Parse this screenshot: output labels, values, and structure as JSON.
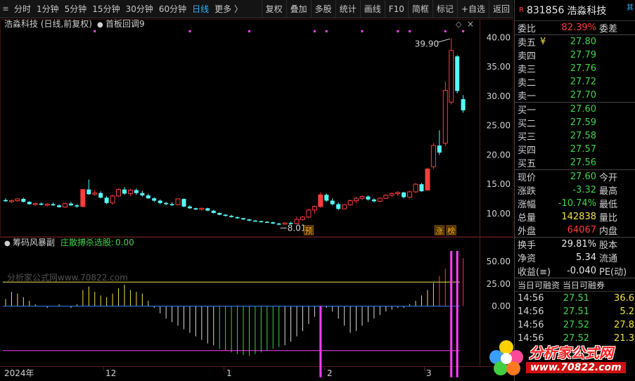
{
  "toolbar": {
    "periods": [
      "分时",
      "1分钟",
      "5分钟",
      "15分钟",
      "30分钟",
      "60分钟",
      "日线",
      "更多 〉"
    ],
    "active_period": "日线",
    "buttons": [
      "复权",
      "叠加",
      "多股",
      "统计",
      "画线",
      "F10",
      "简框",
      "标记",
      "+自选",
      "返回"
    ]
  },
  "main_chart": {
    "title": "浩淼科技 (日线,前复权)",
    "indicator": "首板回调9",
    "price_ticks": [
      "40.00",
      "35.00",
      "30.00",
      "25.00",
      "20.00",
      "15.00",
      "10.00"
    ],
    "high_label": "39.90",
    "low_label": "8.01",
    "badge_yu": "预",
    "badge_zhang": "涨",
    "badge_bang": "榜"
  },
  "sub_chart": {
    "name": "筹码风暴副",
    "formula_label": "庄散搏杀选股:",
    "formula_value": "0.00",
    "ticks": [
      "50.00",
      "25.00",
      "0.00"
    ],
    "watermark": "分析家公式网www.70822.com"
  },
  "x_axis": {
    "labels": [
      "2024年",
      "12",
      "1",
      "2",
      "3"
    ]
  },
  "quote": {
    "badge": "R",
    "code": "831856",
    "name": "浩淼科技",
    "corner": "其",
    "webi_label": "委比",
    "webi_value": "82.39%",
    "weicha_label": "委差",
    "asks": [
      {
        "label": "卖五",
        "price": "27.80",
        "mark": "¥"
      },
      {
        "label": "卖四",
        "price": "27.79",
        "mark": ""
      },
      {
        "label": "卖三",
        "price": "27.76",
        "mark": ""
      },
      {
        "label": "卖二",
        "price": "27.72",
        "mark": ""
      },
      {
        "label": "卖一",
        "price": "27.70",
        "mark": ""
      }
    ],
    "bids": [
      {
        "label": "买一",
        "price": "27.60"
      },
      {
        "label": "买二",
        "price": "27.59"
      },
      {
        "label": "买三",
        "price": "27.58"
      },
      {
        "label": "买四",
        "price": "27.57"
      },
      {
        "label": "买五",
        "price": "27.56"
      }
    ],
    "stats": [
      {
        "l1": "现价",
        "v1": "27.60",
        "c1": "green",
        "l2": "今开"
      },
      {
        "l1": "涨跌",
        "v1": "-3.32",
        "c1": "green",
        "l2": "最高"
      },
      {
        "l1": "涨幅",
        "v1": "-10.74%",
        "c1": "green",
        "l2": "最低"
      },
      {
        "l1": "总量",
        "v1": "142838",
        "c1": "yellow",
        "l2": "量比"
      },
      {
        "l1": "外盘",
        "v1": "64067",
        "c1": "red",
        "l2": "内盘"
      }
    ],
    "stats2": [
      {
        "l1": "换手",
        "v1": "29.81%",
        "c1": "white",
        "l2": "股本"
      },
      {
        "l1": "净资",
        "v1": "5.34",
        "c1": "white",
        "l2": "流通"
      },
      {
        "l1": "收益(≡)",
        "v1": "-0.040",
        "c1": "white",
        "l2": "PE(动)"
      }
    ],
    "margin_head_1": "当日可融资",
    "margin_head_2": "当日可融券",
    "ticks": [
      {
        "time": "14:56",
        "price": "27.51",
        "vol": "36.6"
      },
      {
        "time": "14:56",
        "price": "27.51",
        "vol": "5.2"
      },
      {
        "time": "14:56",
        "price": "27.52",
        "vol": "27.8"
      },
      {
        "time": "14:56",
        "price": "27.52",
        "vol": "21.3"
      }
    ]
  },
  "logo": {
    "title": "分析家公式网",
    "url": "www.70822.com"
  },
  "colors": {
    "up": "#ff3c3c",
    "down": "#54ffff",
    "magenta": "#ff40ff",
    "yellow": "#f0e040",
    "green": "#3ed34a",
    "blue": "#2fb4ff"
  },
  "chart_data": {
    "type": "candlestick",
    "candles": [
      [
        12.3,
        12.6,
        12.0,
        12.1
      ],
      [
        12.1,
        12.4,
        11.8,
        12.2
      ],
      [
        12.2,
        12.6,
        12.0,
        12.5
      ],
      [
        12.5,
        12.7,
        11.9,
        12.0
      ],
      [
        12.0,
        12.1,
        11.5,
        11.6
      ],
      [
        11.6,
        11.9,
        11.3,
        11.7
      ],
      [
        11.7,
        11.9,
        11.4,
        11.5
      ],
      [
        11.5,
        11.8,
        11.2,
        11.6
      ],
      [
        11.6,
        11.9,
        11.3,
        11.4
      ],
      [
        11.4,
        11.6,
        11.0,
        11.1
      ],
      [
        11.1,
        11.8,
        11.0,
        11.7
      ],
      [
        11.7,
        12.0,
        11.3,
        11.4
      ],
      [
        11.4,
        11.6,
        11.0,
        11.2
      ],
      [
        11.2,
        13.0,
        11.1,
        14.1
      ],
      [
        14.1,
        15.8,
        13.2,
        13.3
      ],
      [
        13.3,
        14.0,
        13.0,
        13.5
      ],
      [
        13.5,
        13.8,
        12.6,
        12.7
      ],
      [
        12.7,
        13.0,
        11.6,
        11.8
      ],
      [
        11.8,
        13.2,
        11.5,
        13.0
      ],
      [
        13.0,
        14.3,
        12.8,
        14.1
      ],
      [
        14.1,
        14.5,
        13.2,
        13.4
      ],
      [
        13.4,
        14.2,
        13.0,
        14.0
      ],
      [
        14.0,
        14.3,
        13.2,
        13.5
      ],
      [
        13.5,
        13.9,
        12.9,
        13.1
      ],
      [
        13.1,
        13.4,
        12.5,
        12.6
      ],
      [
        12.6,
        12.8,
        12.0,
        12.2
      ],
      [
        12.2,
        12.4,
        11.6,
        11.8
      ],
      [
        11.8,
        12.0,
        11.4,
        11.6
      ],
      [
        11.6,
        11.9,
        11.3,
        11.5
      ],
      [
        11.5,
        12.6,
        11.4,
        12.5
      ],
      [
        12.5,
        12.6,
        11.1,
        11.2
      ],
      [
        11.2,
        11.4,
        10.8,
        10.9
      ],
      [
        10.9,
        11.0,
        10.6,
        10.7
      ],
      [
        10.7,
        11.0,
        10.5,
        10.9
      ],
      [
        10.9,
        11.0,
        10.4,
        10.5
      ],
      [
        10.5,
        10.6,
        10.0,
        10.1
      ],
      [
        10.1,
        10.2,
        9.7,
        9.8
      ],
      [
        9.8,
        9.9,
        9.5,
        9.6
      ],
      [
        9.6,
        9.8,
        9.3,
        9.4
      ],
      [
        9.4,
        9.5,
        9.1,
        9.2
      ],
      [
        9.2,
        9.3,
        8.9,
        9.0
      ],
      [
        9.0,
        9.1,
        8.7,
        8.8
      ],
      [
        8.8,
        8.9,
        8.6,
        8.7
      ],
      [
        8.7,
        8.8,
        8.5,
        8.6
      ],
      [
        8.6,
        8.7,
        8.4,
        8.5
      ],
      [
        8.5,
        8.6,
        8.2,
        8.3
      ],
      [
        8.3,
        8.4,
        8.01,
        8.2
      ],
      [
        8.2,
        8.5,
        8.1,
        8.4
      ],
      [
        8.4,
        8.6,
        8.2,
        8.3
      ],
      [
        8.3,
        9.5,
        8.2,
        9.0
      ],
      [
        9.0,
        9.6,
        8.8,
        9.4
      ],
      [
        9.4,
        10.8,
        9.2,
        10.6
      ],
      [
        10.6,
        11.4,
        10.0,
        11.2
      ],
      [
        11.2,
        13.6,
        11.0,
        13.2
      ],
      [
        13.2,
        13.4,
        12.0,
        12.2
      ],
      [
        12.2,
        12.6,
        11.4,
        11.6
      ],
      [
        11.6,
        11.9,
        10.6,
        10.8
      ],
      [
        10.8,
        11.6,
        10.7,
        11.5
      ],
      [
        11.5,
        12.4,
        11.3,
        12.2
      ],
      [
        12.2,
        12.8,
        11.8,
        12.6
      ],
      [
        12.6,
        13.1,
        12.3,
        12.9
      ],
      [
        12.9,
        13.1,
        12.2,
        12.4
      ],
      [
        12.4,
        12.6,
        11.9,
        12.1
      ],
      [
        12.1,
        12.8,
        12.0,
        12.6
      ],
      [
        12.6,
        13.3,
        12.5,
        13.1
      ],
      [
        13.1,
        13.6,
        12.9,
        13.4
      ],
      [
        13.4,
        13.8,
        13.0,
        13.6
      ],
      [
        13.6,
        13.7,
        12.6,
        12.8
      ],
      [
        12.8,
        13.9,
        12.6,
        13.7
      ],
      [
        13.7,
        15.2,
        13.5,
        15.0
      ],
      [
        15.0,
        15.2,
        13.7,
        13.8
      ],
      [
        14.0,
        17.8,
        14.0,
        17.6
      ],
      [
        18.0,
        22.0,
        17.6,
        21.6
      ],
      [
        21.6,
        24.2,
        20.0,
        20.4
      ],
      [
        22.0,
        32.5,
        21.5,
        31.0
      ],
      [
        29.0,
        39.9,
        28.6,
        37.8
      ],
      [
        36.8,
        37.0,
        30.5,
        30.9
      ],
      [
        29.5,
        30.2,
        27.2,
        27.6
      ]
    ],
    "y_range": [
      6.5,
      41.5
    ],
    "sub_bars": [
      8,
      16,
      14,
      10,
      6,
      2,
      0,
      -2,
      0,
      2,
      0,
      -2,
      2,
      18,
      22,
      16,
      12,
      10,
      14,
      20,
      24,
      18,
      16,
      14,
      6,
      -2,
      -8,
      -14,
      -18,
      -22,
      -26,
      -30,
      -34,
      -38,
      -42,
      -44,
      -48,
      -50,
      -52,
      -54,
      -55,
      -56,
      -54,
      -52,
      -50,
      -48,
      -46,
      -44,
      -40,
      -34,
      -28,
      -20,
      -12,
      -4,
      -2,
      -6,
      -14,
      -22,
      -30,
      -28,
      -22,
      -18,
      -14,
      -10,
      -6,
      -4,
      -2,
      -2,
      2,
      6,
      12,
      18,
      26,
      34,
      42,
      48,
      52,
      54
    ],
    "sub_range": [
      -66,
      62
    ],
    "yellow_level": 27,
    "magenta_level": -50,
    "spikes": [
      {
        "index": 53,
        "low": -80,
        "high": 0
      },
      {
        "index": 75,
        "low": -80,
        "high": 62
      },
      {
        "index": 76,
        "low": -80,
        "high": 62
      }
    ],
    "top_markers": [
      15,
      31,
      41,
      52,
      54,
      60,
      66,
      68,
      74,
      77
    ]
  }
}
